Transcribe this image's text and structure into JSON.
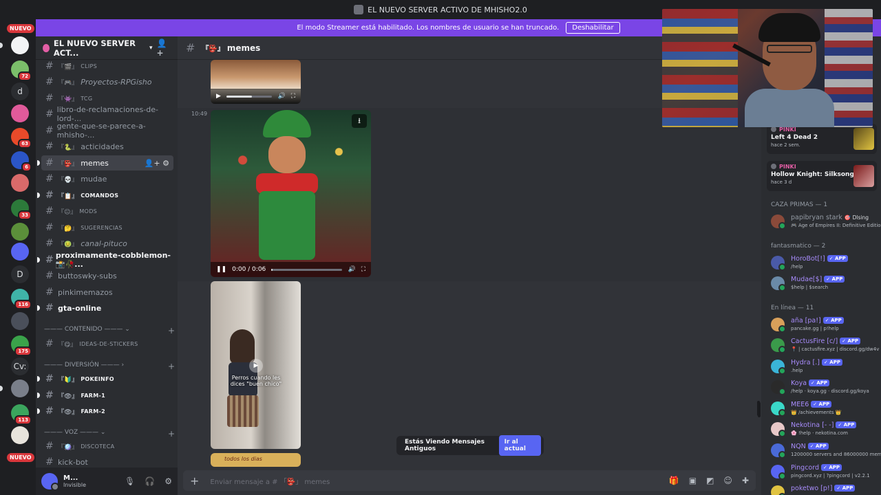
{
  "window": {
    "title": "EL NUEVO SERVER ACTIVO DE MHISHO2.0"
  },
  "banner": {
    "text": "El modo Streamer está habilitado. Los nombres de usuario se han truncado.",
    "button": "Deshabilitar"
  },
  "rail": {
    "new_label": "NUEVO",
    "letters": [
      "d",
      "D",
      "Cv:"
    ],
    "badges": [
      "72",
      "63",
      "6",
      "33",
      "116",
      "175",
      "113"
    ]
  },
  "guild": {
    "name": "EL NUEVO SERVER ACT..."
  },
  "channels": {
    "clips": "CLIPS",
    "proyectos": "Proyectos-RPGisho",
    "tcg": "TCG",
    "libro": "libro-de-reclamaciones-de-lord-...",
    "gente": "gente-que-se-parece-a-mhisho-...",
    "actividades": "acticidades",
    "memes": "memes",
    "mudae": "mudae",
    "comandos": "COMANDOS",
    "mods": "MODS",
    "sugerencias": "SUGERENCIAS",
    "canal_pituco": "canal-pituco",
    "proximamente": "proximamente-cobblemon-📸🥀...",
    "buttoswky": "buttoswky-subs",
    "pinkimemazos": "pinkimemazos",
    "gta": "gta-online",
    "cat_contenido": "——— CONTENIDO ———",
    "ideas": "IDEAS-DE-STICKERS",
    "cat_diversion": "——— DIVERSIÓN ———",
    "pokeinfo": "POKEINFO",
    "farm1": "FARM-1",
    "farm2": "FARM-2",
    "cat_voz": "——— VOZ ———",
    "discoteca": "DISCOTECA",
    "kickbot": "kick-bot"
  },
  "user": {
    "name": "M...",
    "status": "Invisible"
  },
  "chat": {
    "channel": "memes",
    "timestamp": "10:49",
    "video_time": "0:00 / 0:06",
    "caption": "Perros cuando les dices \"buen chico\"",
    "next_caption": "todos los dias",
    "old_messages": "Estás Viendo Mensajes Antiguos",
    "jump": "Ir al actual",
    "composer_placeholder": "Enviar mensaje a # 「👺」 memes"
  },
  "members": {
    "activity": [
      {
        "user": "PINKI",
        "game": "Left 4 Dead 2",
        "when": "hace 2 sem."
      },
      {
        "user": "PINKI",
        "game": "Hollow Knight: Silksong",
        "when": "hace 3 d"
      }
    ],
    "cat_caza": "CAZA PRIMAS — 1",
    "caza": [
      {
        "name": "papibryan stark",
        "tag": "🎯 Dlsing",
        "status": "🎮 Age of Empires II: Definitive Edition",
        "color": "#949ba4"
      }
    ],
    "cat_fantasmatico": "fantasmatico — 2",
    "fantasmatico": [
      {
        "name": "HoroBot[!]",
        "status": "/help",
        "color": "#a78bfa"
      },
      {
        "name": "Mudae[$]",
        "status": "$help | $search",
        "color": "#a78bfa"
      }
    ],
    "cat_online": "En línea — 11",
    "online": [
      {
        "name": "aña [pa!]",
        "status": "pancake.gg | p!help",
        "color": "#a78bfa"
      },
      {
        "name": "CactusFire [c/]",
        "status": "📍 | cactusfire.xyz | discord.gg/dw4v",
        "color": "#a78bfa"
      },
      {
        "name": "Hydra [.]",
        "status": ".help",
        "color": "#a78bfa"
      },
      {
        "name": "Koya",
        "status": "/help · koya.gg · discord.gg/koya",
        "color": "#a78bfa"
      },
      {
        "name": "MEE6",
        "status": "👑 /achievements 👑",
        "color": "#a78bfa"
      },
      {
        "name": "Nekotina [- -]",
        "status": "🌸 !help · nekotina.com",
        "color": "#a78bfa"
      },
      {
        "name": "NQN",
        "status": "1200000 servers and 86000000 mem",
        "color": "#a78bfa"
      },
      {
        "name": "Pingcord",
        "status": "pingcord.xyz | ?pingcord | v2.2.1",
        "color": "#a78bfa"
      },
      {
        "name": "poketwo [p!]",
        "status": "",
        "color": "#a78bfa"
      }
    ],
    "app_label": "✓ APP"
  }
}
